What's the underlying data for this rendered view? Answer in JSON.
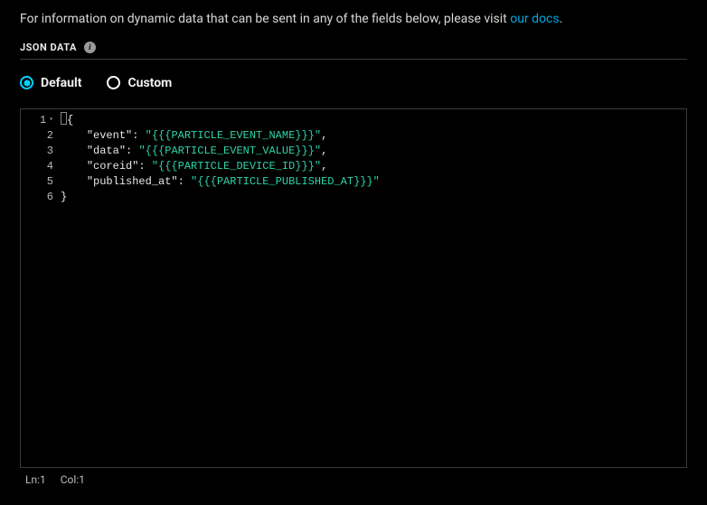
{
  "intro": {
    "text_before": "For information on dynamic data that can be sent in any of the fields below, please visit ",
    "link_text": "our docs",
    "text_after": "."
  },
  "section": {
    "label": "JSON DATA",
    "info_glyph": "i"
  },
  "options": {
    "default_label": "Default",
    "custom_label": "Custom",
    "selected": "default"
  },
  "editor": {
    "line_numbers": [
      "1",
      "2",
      "3",
      "4",
      "5",
      "6"
    ],
    "lines": [
      {
        "segments": [
          {
            "t": "{",
            "c": "punct",
            "cursor_before": true
          }
        ]
      },
      {
        "segments": [
          {
            "t": "    ",
            "c": "plain"
          },
          {
            "t": "\"event\"",
            "c": "key"
          },
          {
            "t": ": ",
            "c": "punct"
          },
          {
            "t": "\"{{{PARTICLE_EVENT_NAME}}}\"",
            "c": "str"
          },
          {
            "t": ",",
            "c": "punct"
          }
        ]
      },
      {
        "segments": [
          {
            "t": "    ",
            "c": "plain"
          },
          {
            "t": "\"data\"",
            "c": "key"
          },
          {
            "t": ": ",
            "c": "punct"
          },
          {
            "t": "\"{{{PARTICLE_EVENT_VALUE}}}\"",
            "c": "str"
          },
          {
            "t": ",",
            "c": "punct"
          }
        ]
      },
      {
        "segments": [
          {
            "t": "    ",
            "c": "plain"
          },
          {
            "t": "\"coreid\"",
            "c": "key"
          },
          {
            "t": ": ",
            "c": "punct"
          },
          {
            "t": "\"{{{PARTICLE_DEVICE_ID}}}\"",
            "c": "str"
          },
          {
            "t": ",",
            "c": "punct"
          }
        ]
      },
      {
        "segments": [
          {
            "t": "    ",
            "c": "plain"
          },
          {
            "t": "\"published_at\"",
            "c": "key"
          },
          {
            "t": ": ",
            "c": "punct"
          },
          {
            "t": "\"{{{PARTICLE_PUBLISHED_AT}}}\"",
            "c": "str"
          }
        ]
      },
      {
        "segments": [
          {
            "t": "}",
            "c": "punct"
          }
        ]
      }
    ]
  },
  "status": {
    "ln_label": "Ln:",
    "ln_value": "1",
    "col_label": "Col:",
    "col_value": "1"
  }
}
